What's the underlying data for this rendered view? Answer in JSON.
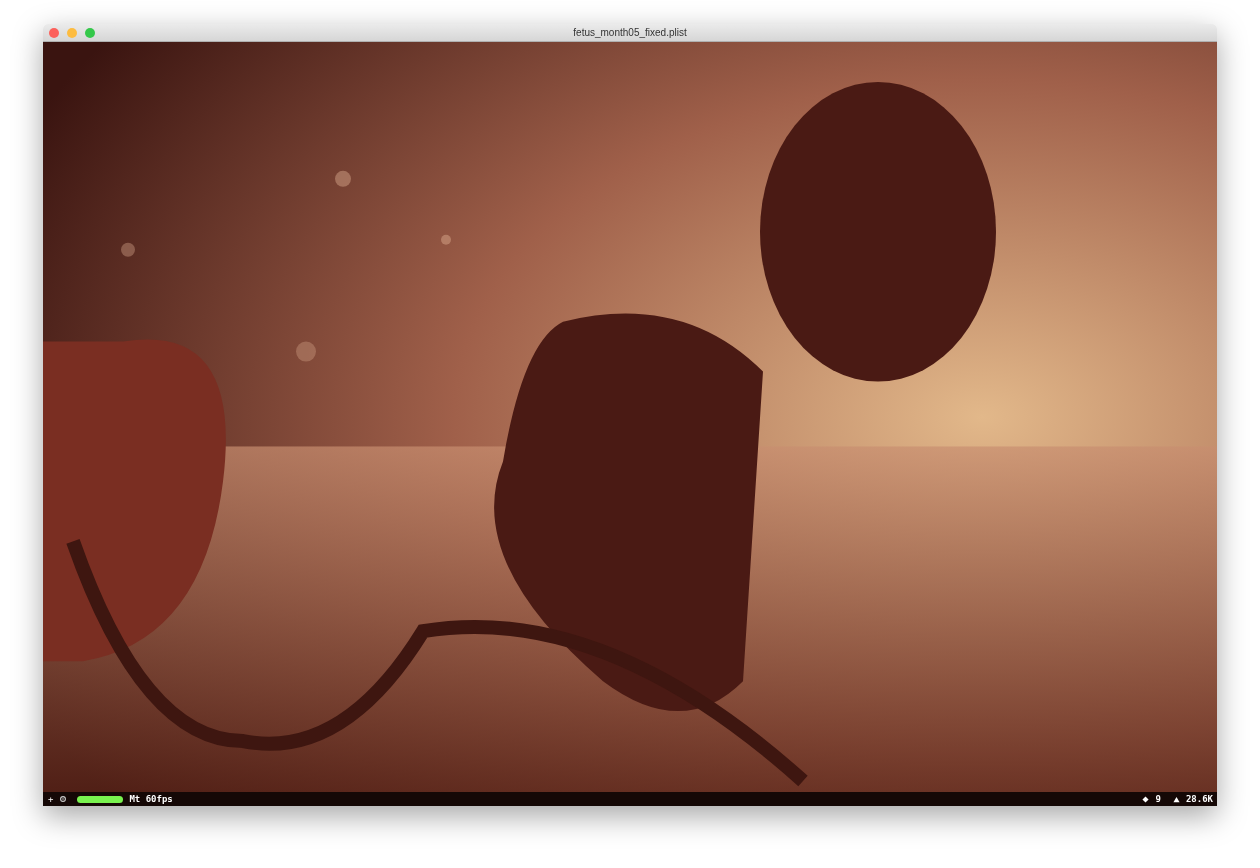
{
  "window": {
    "title": "fetus_month05_fixed.plist"
  },
  "status_bar": {
    "add_label": "+",
    "frame_rate": "Mt 60fps",
    "node_count": "9",
    "triangle_count": "28.6K"
  }
}
